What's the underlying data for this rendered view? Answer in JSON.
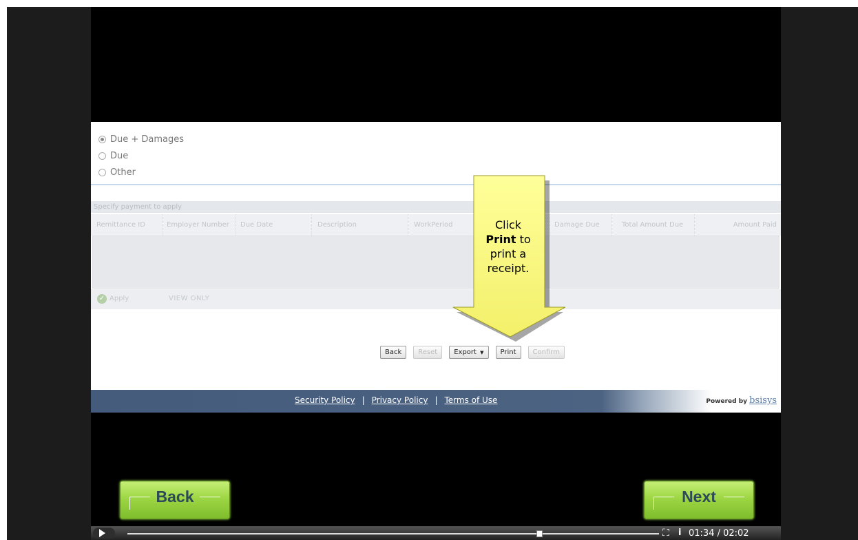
{
  "payment_options": [
    {
      "label": "Due + Damages",
      "selected": true
    },
    {
      "label": "Due",
      "selected": false
    },
    {
      "label": "Other",
      "selected": false
    }
  ],
  "grid": {
    "caption": "Specify payment to apply",
    "columns": [
      "Remittance ID",
      "Employer Number",
      "Due Date",
      "Description",
      "WorkPeriod",
      "",
      "Damage Due",
      "Total Amount Due",
      "Amount Paid"
    ],
    "footer_apply": "Apply",
    "footer_view": "VIEW ONLY"
  },
  "page_buttons": {
    "back": "Back",
    "reset": "Reset",
    "export": "Export",
    "print": "Print",
    "confirm": "Confirm"
  },
  "footer": {
    "security": "Security Policy",
    "privacy": "Privacy Policy",
    "terms": "Terms of Use",
    "separator": "|",
    "powered_by": "Powered by",
    "brand": "bsisys"
  },
  "callout": {
    "line1": "Click",
    "bold": "Print",
    "line2": " to",
    "line3": "print a",
    "line4": "receipt."
  },
  "nav": {
    "back": "Back",
    "next": "Next"
  },
  "player": {
    "time": "01:34 / 02:02",
    "progress": 0.775,
    "fullscreen_icon": "fullscreen-icon",
    "info_icon": "info-icon"
  }
}
